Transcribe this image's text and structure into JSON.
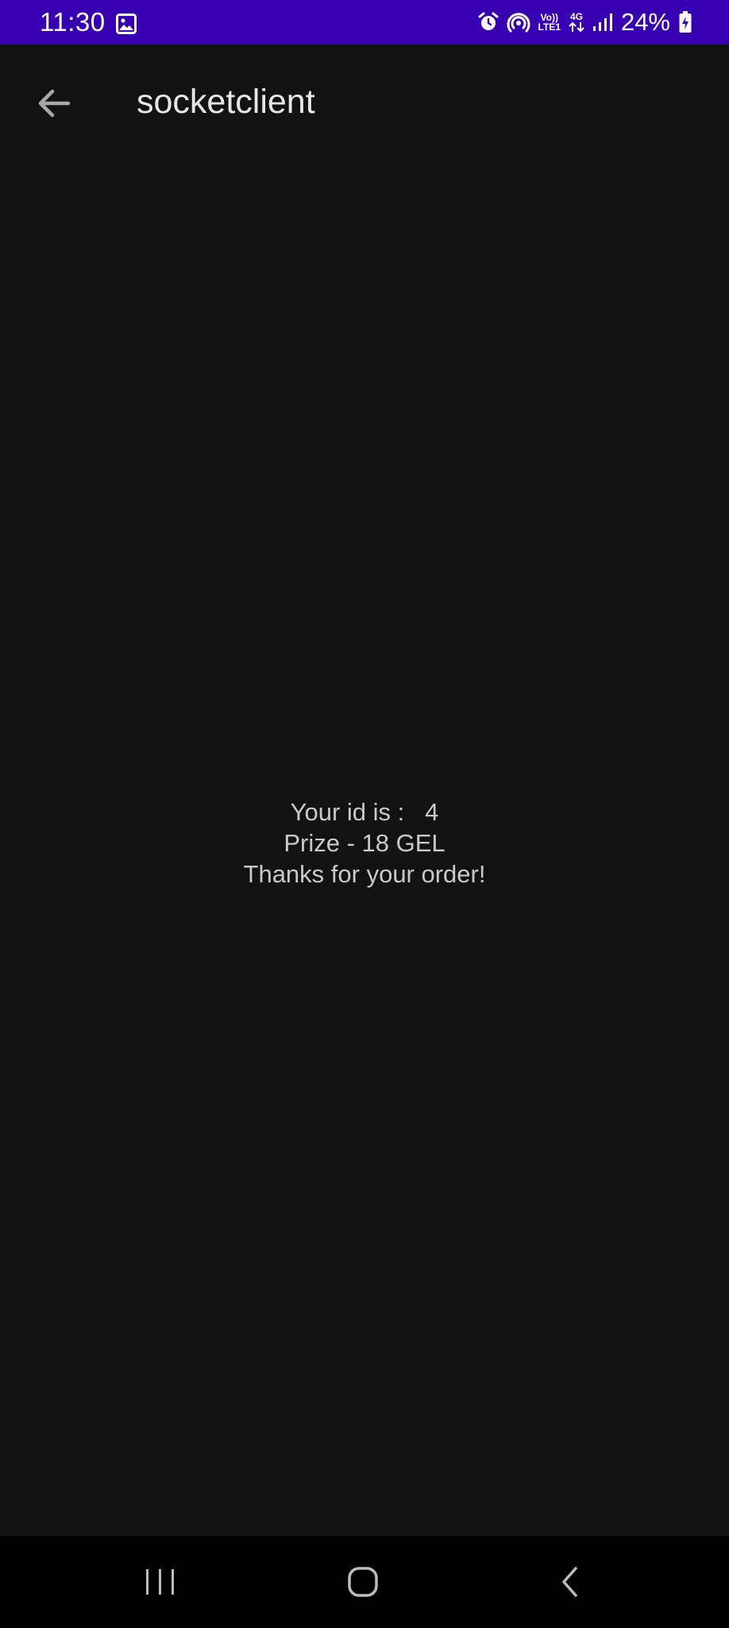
{
  "status_bar": {
    "time": "11:30",
    "network_volte": "Vo))",
    "network_lte": "LTE1",
    "network_type": "4G",
    "battery": "24%",
    "icons": [
      "gallery-icon",
      "alarm-icon",
      "hotspot-icon",
      "signal-icon",
      "battery-charging-icon"
    ],
    "background_color": "#3700b3"
  },
  "app_bar": {
    "title": "socketclient",
    "back_icon": "arrow-left-icon"
  },
  "main": {
    "line1": "Your id is :   4",
    "line2": "Prize - 18 GEL",
    "line3": "Thanks for your order!"
  },
  "nav_bar": {
    "icons": [
      "recents-icon",
      "home-icon",
      "back-icon"
    ]
  },
  "colors": {
    "background": "#121212",
    "status_bar": "#3700b3",
    "text": "#c9c9c9",
    "nav_bar": "#000000"
  }
}
